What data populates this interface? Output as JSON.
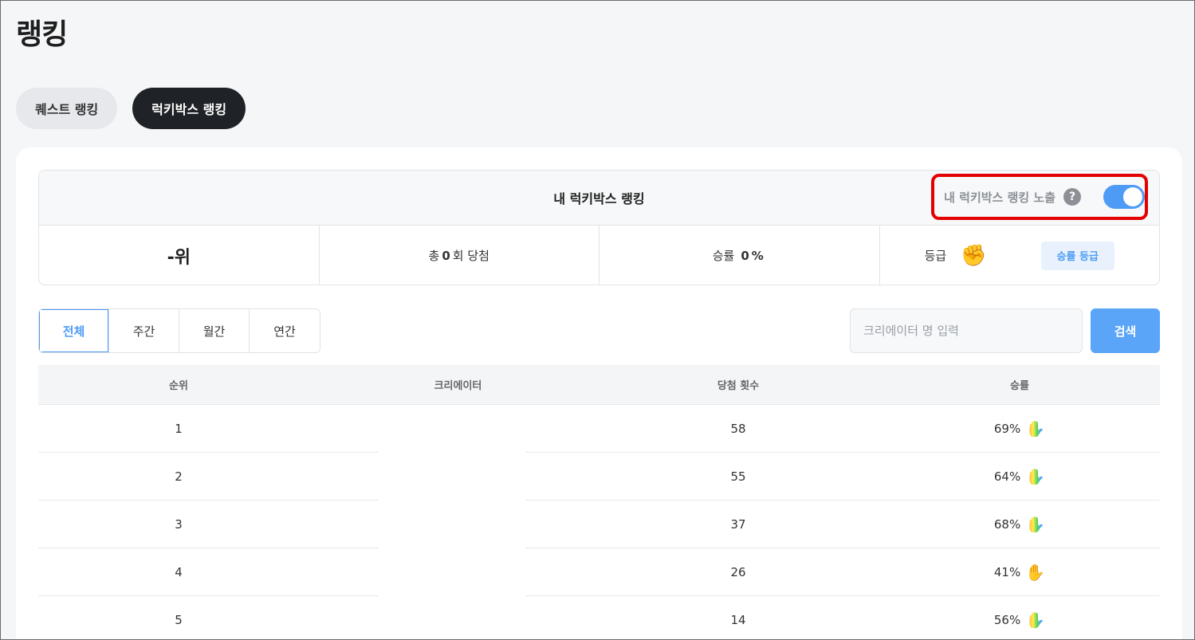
{
  "page": {
    "title": "랭킹"
  },
  "tabs": [
    {
      "label": "퀘스트 랭킹",
      "active": false
    },
    {
      "label": "럭키박스 랭킹",
      "active": true
    }
  ],
  "my_rank": {
    "title": "내 럭키박스 랭킹",
    "expose_label": "내 럭키박스 랭킹 노출",
    "help_glyph": "?",
    "expose_enabled": true,
    "rank": "-위",
    "total_prefix": "총",
    "total_count": "0",
    "total_suffix": "회 당첨",
    "rate_label": "승률",
    "rate_value": "0",
    "rate_unit": "%",
    "grade_label": "등급",
    "grade_icon": "fist-icon",
    "grade_button": "승률 등급"
  },
  "period_tabs": [
    {
      "label": "전체",
      "active": true
    },
    {
      "label": "주간",
      "active": false
    },
    {
      "label": "월간",
      "active": false
    },
    {
      "label": "연간",
      "active": false
    }
  ],
  "search": {
    "placeholder": "크리에이터 명 입력",
    "button": "검색"
  },
  "table": {
    "headers": [
      "순위",
      "크리에이터",
      "당첨 횟수",
      "승률"
    ],
    "rows": [
      {
        "rank": "1",
        "creator": "",
        "count": "58",
        "rate": "69%",
        "hand": "rainbow"
      },
      {
        "rank": "2",
        "creator": "",
        "count": "55",
        "rate": "64%",
        "hand": "rainbow"
      },
      {
        "rank": "3",
        "creator": "",
        "count": "37",
        "rate": "68%",
        "hand": "rainbow"
      },
      {
        "rank": "4",
        "creator": "",
        "count": "26",
        "rate": "41%",
        "hand": "plain"
      },
      {
        "rank": "5",
        "creator": "",
        "count": "14",
        "rate": "56%",
        "hand": "rainbow"
      }
    ]
  },
  "colors": {
    "accent": "#4d9bf5",
    "highlight": "#e40000",
    "active_tab": "#1f2226"
  }
}
